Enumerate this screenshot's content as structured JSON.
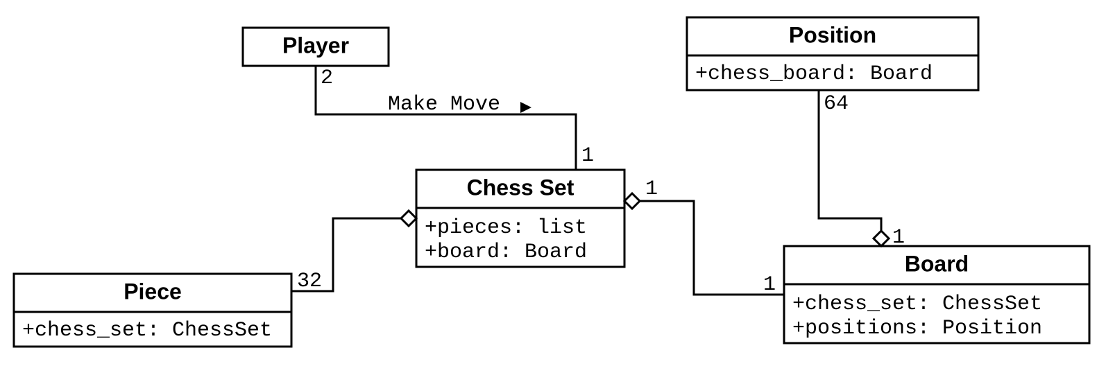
{
  "classes": {
    "player": {
      "name": "Player",
      "attrs": []
    },
    "piece": {
      "name": "Piece",
      "attrs": [
        "+chess_set: ChessSet"
      ]
    },
    "chessset": {
      "name": "Chess Set",
      "attrs": [
        "+pieces: list",
        "+board: Board"
      ]
    },
    "position": {
      "name": "Position",
      "attrs": [
        "+chess_board: Board"
      ]
    },
    "board": {
      "name": "Board",
      "attrs": [
        "+chess_set: ChessSet",
        "+positions: Position"
      ]
    }
  },
  "relations": {
    "player_chessset": {
      "label": "Make Move",
      "m_player": "2",
      "m_chessset": "1"
    },
    "chessset_piece": {
      "m_piece": "32"
    },
    "chessset_board": {
      "m_chessset": "1",
      "m_board": "1"
    },
    "board_position": {
      "m_board": "1",
      "m_position": "64"
    }
  }
}
